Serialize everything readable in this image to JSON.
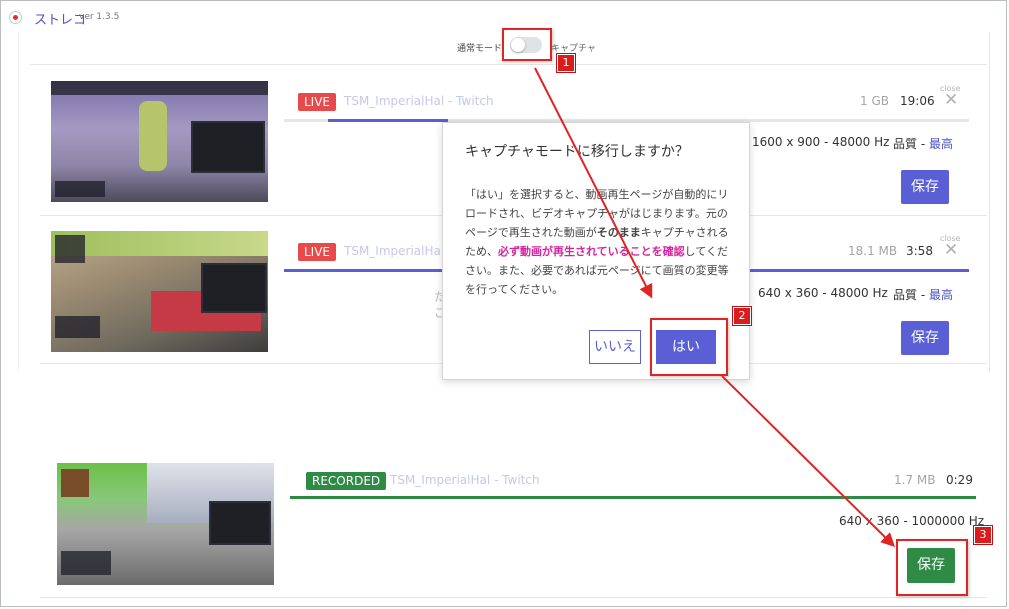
{
  "app": {
    "name": "ストレコ",
    "version": "ver 1.3.5"
  },
  "mode": {
    "label_left": "通常モード",
    "label_right": "キャプチャ"
  },
  "items": [
    {
      "badge": "LIVE",
      "title": "TSM_ImperialHal - Twitch",
      "size": "1 GB",
      "duration": "19:06",
      "close": "close",
      "resolution": "1600 x 900 - 48000 Hz",
      "quality_label": "品質 - ",
      "quality_value": "最高",
      "save": "保存"
    },
    {
      "badge": "LIVE",
      "title": "TSM_ImperialHal - Twitch",
      "size": "18.1 MB",
      "duration": "3:58",
      "close": "close",
      "resolution": "640 x 360 - 48000 Hz",
      "quality_label": "品質 - ",
      "quality_value": "最高",
      "save": "保存"
    },
    {
      "badge": "RECORDED",
      "title": "TSM_ImperialHal - Twitch",
      "size": "1.7 MB",
      "duration": "0:29",
      "resolution": "640 x 360 - 1000000 Hz",
      "save": "保存"
    }
  ],
  "dialog": {
    "title": "キャプチャモードに移行しますか？",
    "body_1": "「はい」を選択すると、動画再生ページが自動的にリロードされ、ビデオキャプチャがはじまります。元のページで再生された動画が",
    "body_em": "そのまま",
    "body_2": "キャプチャされるため、",
    "body_warn": "必ず動画が再生されていることを確認",
    "body_3": "してください。また、必要であれば元ページにて画質の変更等を行ってください。",
    "no": "いいえ",
    "yes": "はい"
  },
  "annotations": [
    "1",
    "2",
    "3"
  ],
  "colors": {
    "accent": "#5a5fd6",
    "live": "#e74a4a",
    "recorded": "#2f8a46",
    "annotation": "#e02424",
    "warn_text": "#d6249f"
  }
}
